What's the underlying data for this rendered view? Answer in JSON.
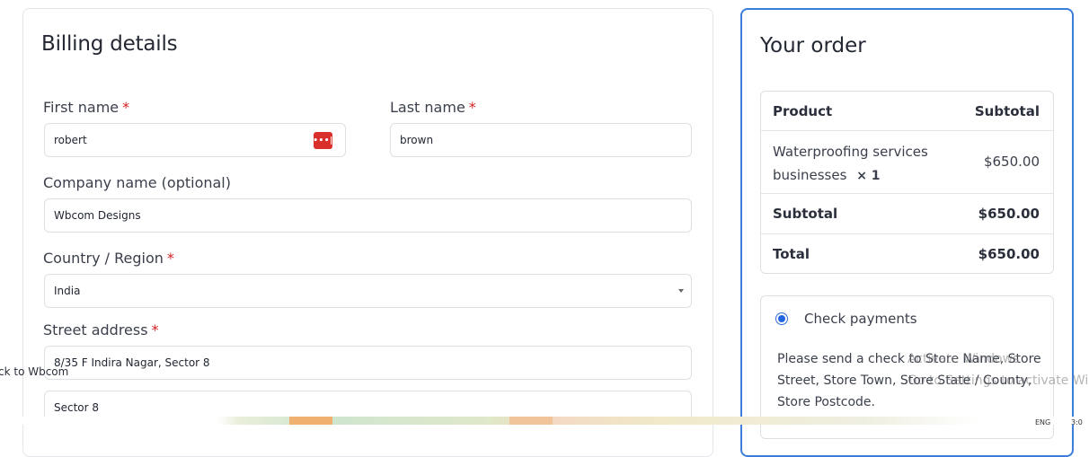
{
  "billing": {
    "title": "Billing details",
    "first_name_label": "First name",
    "first_name_value": "robert",
    "last_name_label": "Last name",
    "last_name_value": "brown",
    "company_label": "Company name (optional)",
    "company_value": "Wbcom Designs",
    "country_label": "Country / Region",
    "country_value": "India",
    "street_label": "Street address",
    "street_line1": "8/35 F Indira Nagar, Sector 8",
    "street_line2": "Sector 8",
    "required_mark": "*",
    "password_badge": "•••|"
  },
  "order": {
    "title": "Your order",
    "col_product": "Product",
    "col_subtotal": "Subtotal",
    "item_name_line1": "Waterproofing services",
    "item_name_line2": "businesses",
    "item_qty": "× 1",
    "item_price": "$650.00",
    "subtotal_label": "Subtotal",
    "subtotal_value": "$650.00",
    "total_label": "Total",
    "total_value": "$650.00"
  },
  "payment": {
    "method_label": "Check payments",
    "description": "Please send a check to Store Name, Store Street, Store Town, Store State / County, Store Postcode."
  },
  "overlay": {
    "back_link": "ck to Wbcom",
    "watermark_line1": "Activate Windows",
    "watermark_line2": "Go to Settings to activate Windows.",
    "tray_lang": "ENG",
    "tray_time": "3:0"
  },
  "colors": {
    "accent_border": "#3b7dd8",
    "required": "#d31f1f",
    "radio": "#1f66e0",
    "password_badge": "#d9302c"
  }
}
